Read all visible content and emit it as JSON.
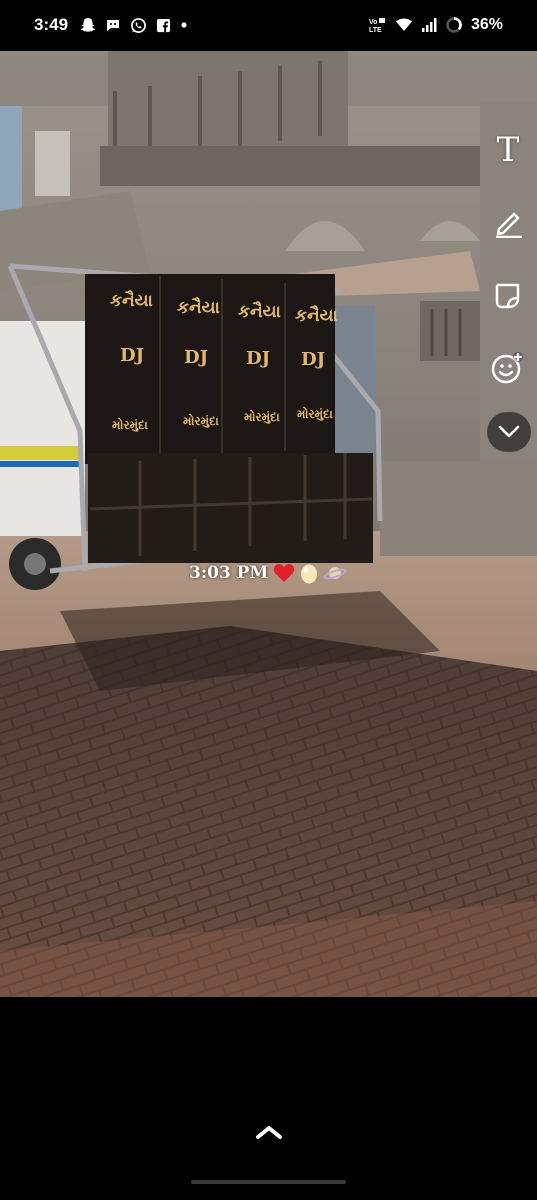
{
  "status_bar": {
    "time": "3:49",
    "notification_icons": [
      "snapchat-icon",
      "chat-icon",
      "whatsapp-icon",
      "facebook-icon",
      "dot-icon"
    ],
    "network_label": "VoLTE",
    "battery_percent": "36%"
  },
  "photo": {
    "speaker_brand": "કનૈયા",
    "speaker_dj": "DJ",
    "speaker_location": "મોરમુંદા"
  },
  "time_sticker": {
    "time": "3:03 PM",
    "emojis": [
      "heart-emoji",
      "egg-emoji",
      "planet-emoji"
    ]
  },
  "toolbar": {
    "text_tool": "T",
    "tools": [
      "text-tool",
      "pencil-tool",
      "sticker-tool",
      "emoji-tool",
      "more-tools"
    ]
  },
  "colors": {
    "background": "#000000",
    "speaker_label": "#e0b86a",
    "heart": "#e0202a"
  }
}
